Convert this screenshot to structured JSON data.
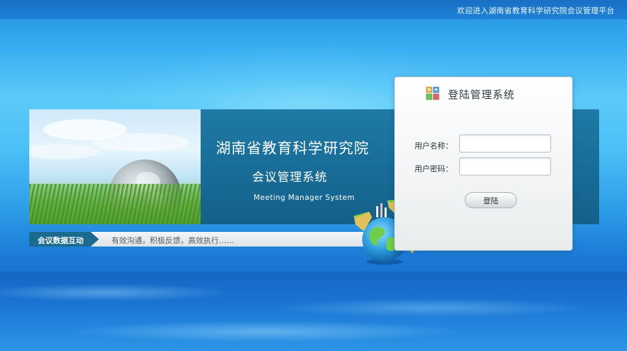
{
  "topbar": {
    "welcome_text": "欢迎进入湖南省教育科学研究院会议管理平台"
  },
  "banner": {
    "title": "湖南省教育科学研究院",
    "subtitle": "会议管理系统",
    "english": "Meeting Manager System"
  },
  "slogan": {
    "tag": "会议数据互动",
    "text": "有效沟通，积极反馈，高效执行……"
  },
  "login": {
    "title": "登陆管理系统",
    "username_label": "用户名称：",
    "username_value": "",
    "password_label": "用户密码：",
    "password_value": "",
    "submit_label": "登陆"
  },
  "icons": {
    "login_icon": "app-grid-icon",
    "globe_decoration": "globe-islands-icon"
  },
  "colors": {
    "banner": "#186d98",
    "topbar": "#1a6fc4",
    "slogan_tag": "#1b6b8f",
    "background_sky": "#4cc0f6"
  }
}
